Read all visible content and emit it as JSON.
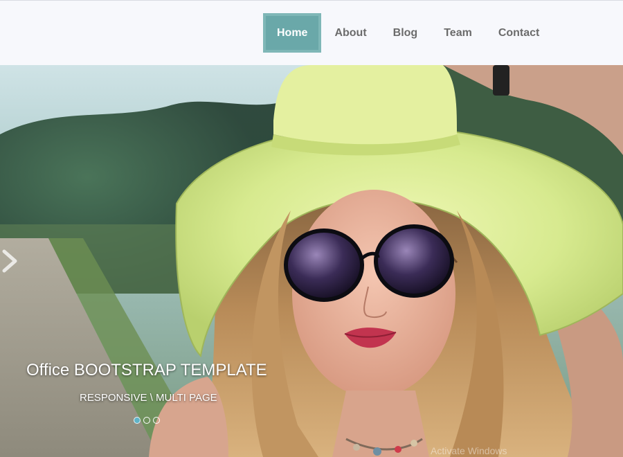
{
  "nav": {
    "items": [
      {
        "label": "Home",
        "active": true
      },
      {
        "label": "About",
        "active": false
      },
      {
        "label": "Blog",
        "active": false
      },
      {
        "label": "Team",
        "active": false
      },
      {
        "label": "Contact",
        "active": false
      }
    ]
  },
  "carousel": {
    "caption_title": "Office BOOTSTRAP TEMPLATE",
    "caption_subtitle": "RESPONSIVE \\ MULTI PAGE",
    "indicators": [
      {
        "active": true
      },
      {
        "active": false
      },
      {
        "active": false
      }
    ],
    "next_icon": "chevron-right-icon",
    "slide_image": "woman-in-sun-hat-photo"
  },
  "watermark": "Activate Windows",
  "colors": {
    "nav_active_bg": "#6aa8a9",
    "header_bg": "#f7f8fc",
    "indicator_active": "#5fb3c7"
  }
}
